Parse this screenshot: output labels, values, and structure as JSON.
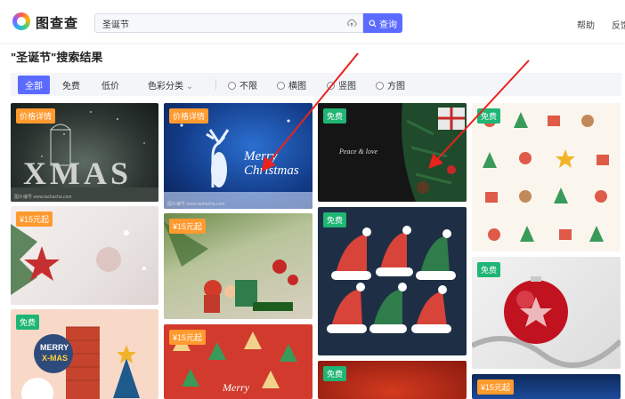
{
  "header": {
    "brand": "图查查",
    "search_value": "圣诞节",
    "search_button_label": "查询",
    "nav_help": "帮助",
    "nav_feedback": "反馈",
    "accent_color": "#5b6bff"
  },
  "page_title": "\"圣诞节\"搜索结果",
  "filters": {
    "tabs": [
      "全部",
      "免费",
      "低价"
    ],
    "color_dropdown": "色彩分类",
    "orientations": [
      "不限",
      "横图",
      "竖图",
      "方图"
    ]
  },
  "cards": [
    {
      "badge": "价格详情",
      "image_text": "XMAS",
      "watermark": "图片编号 www.tuchacha.com"
    },
    {
      "badge": "¥15元起",
      "watermark": ""
    },
    {
      "badge": "免费"
    },
    {
      "badge": "价格详情",
      "image_text": "Merry Christmas",
      "watermark": "图片编号 www.tuchacha.com"
    },
    {
      "badge": "¥15元起"
    },
    {
      "badge": "¥15元起",
      "image_text": "Merry"
    },
    {
      "badge": "免费",
      "image_text": "Peace & love"
    },
    {
      "badge": "免费"
    },
    {
      "badge": "免费"
    },
    {
      "badge": "免费"
    },
    {
      "badge": "免费"
    },
    {
      "badge": "¥15元起"
    }
  ],
  "image_texts": {
    "merry_xmas_line1": "MERRY",
    "merry_xmas_line2": "X-MAS"
  },
  "annotation_color": "#e8231e"
}
